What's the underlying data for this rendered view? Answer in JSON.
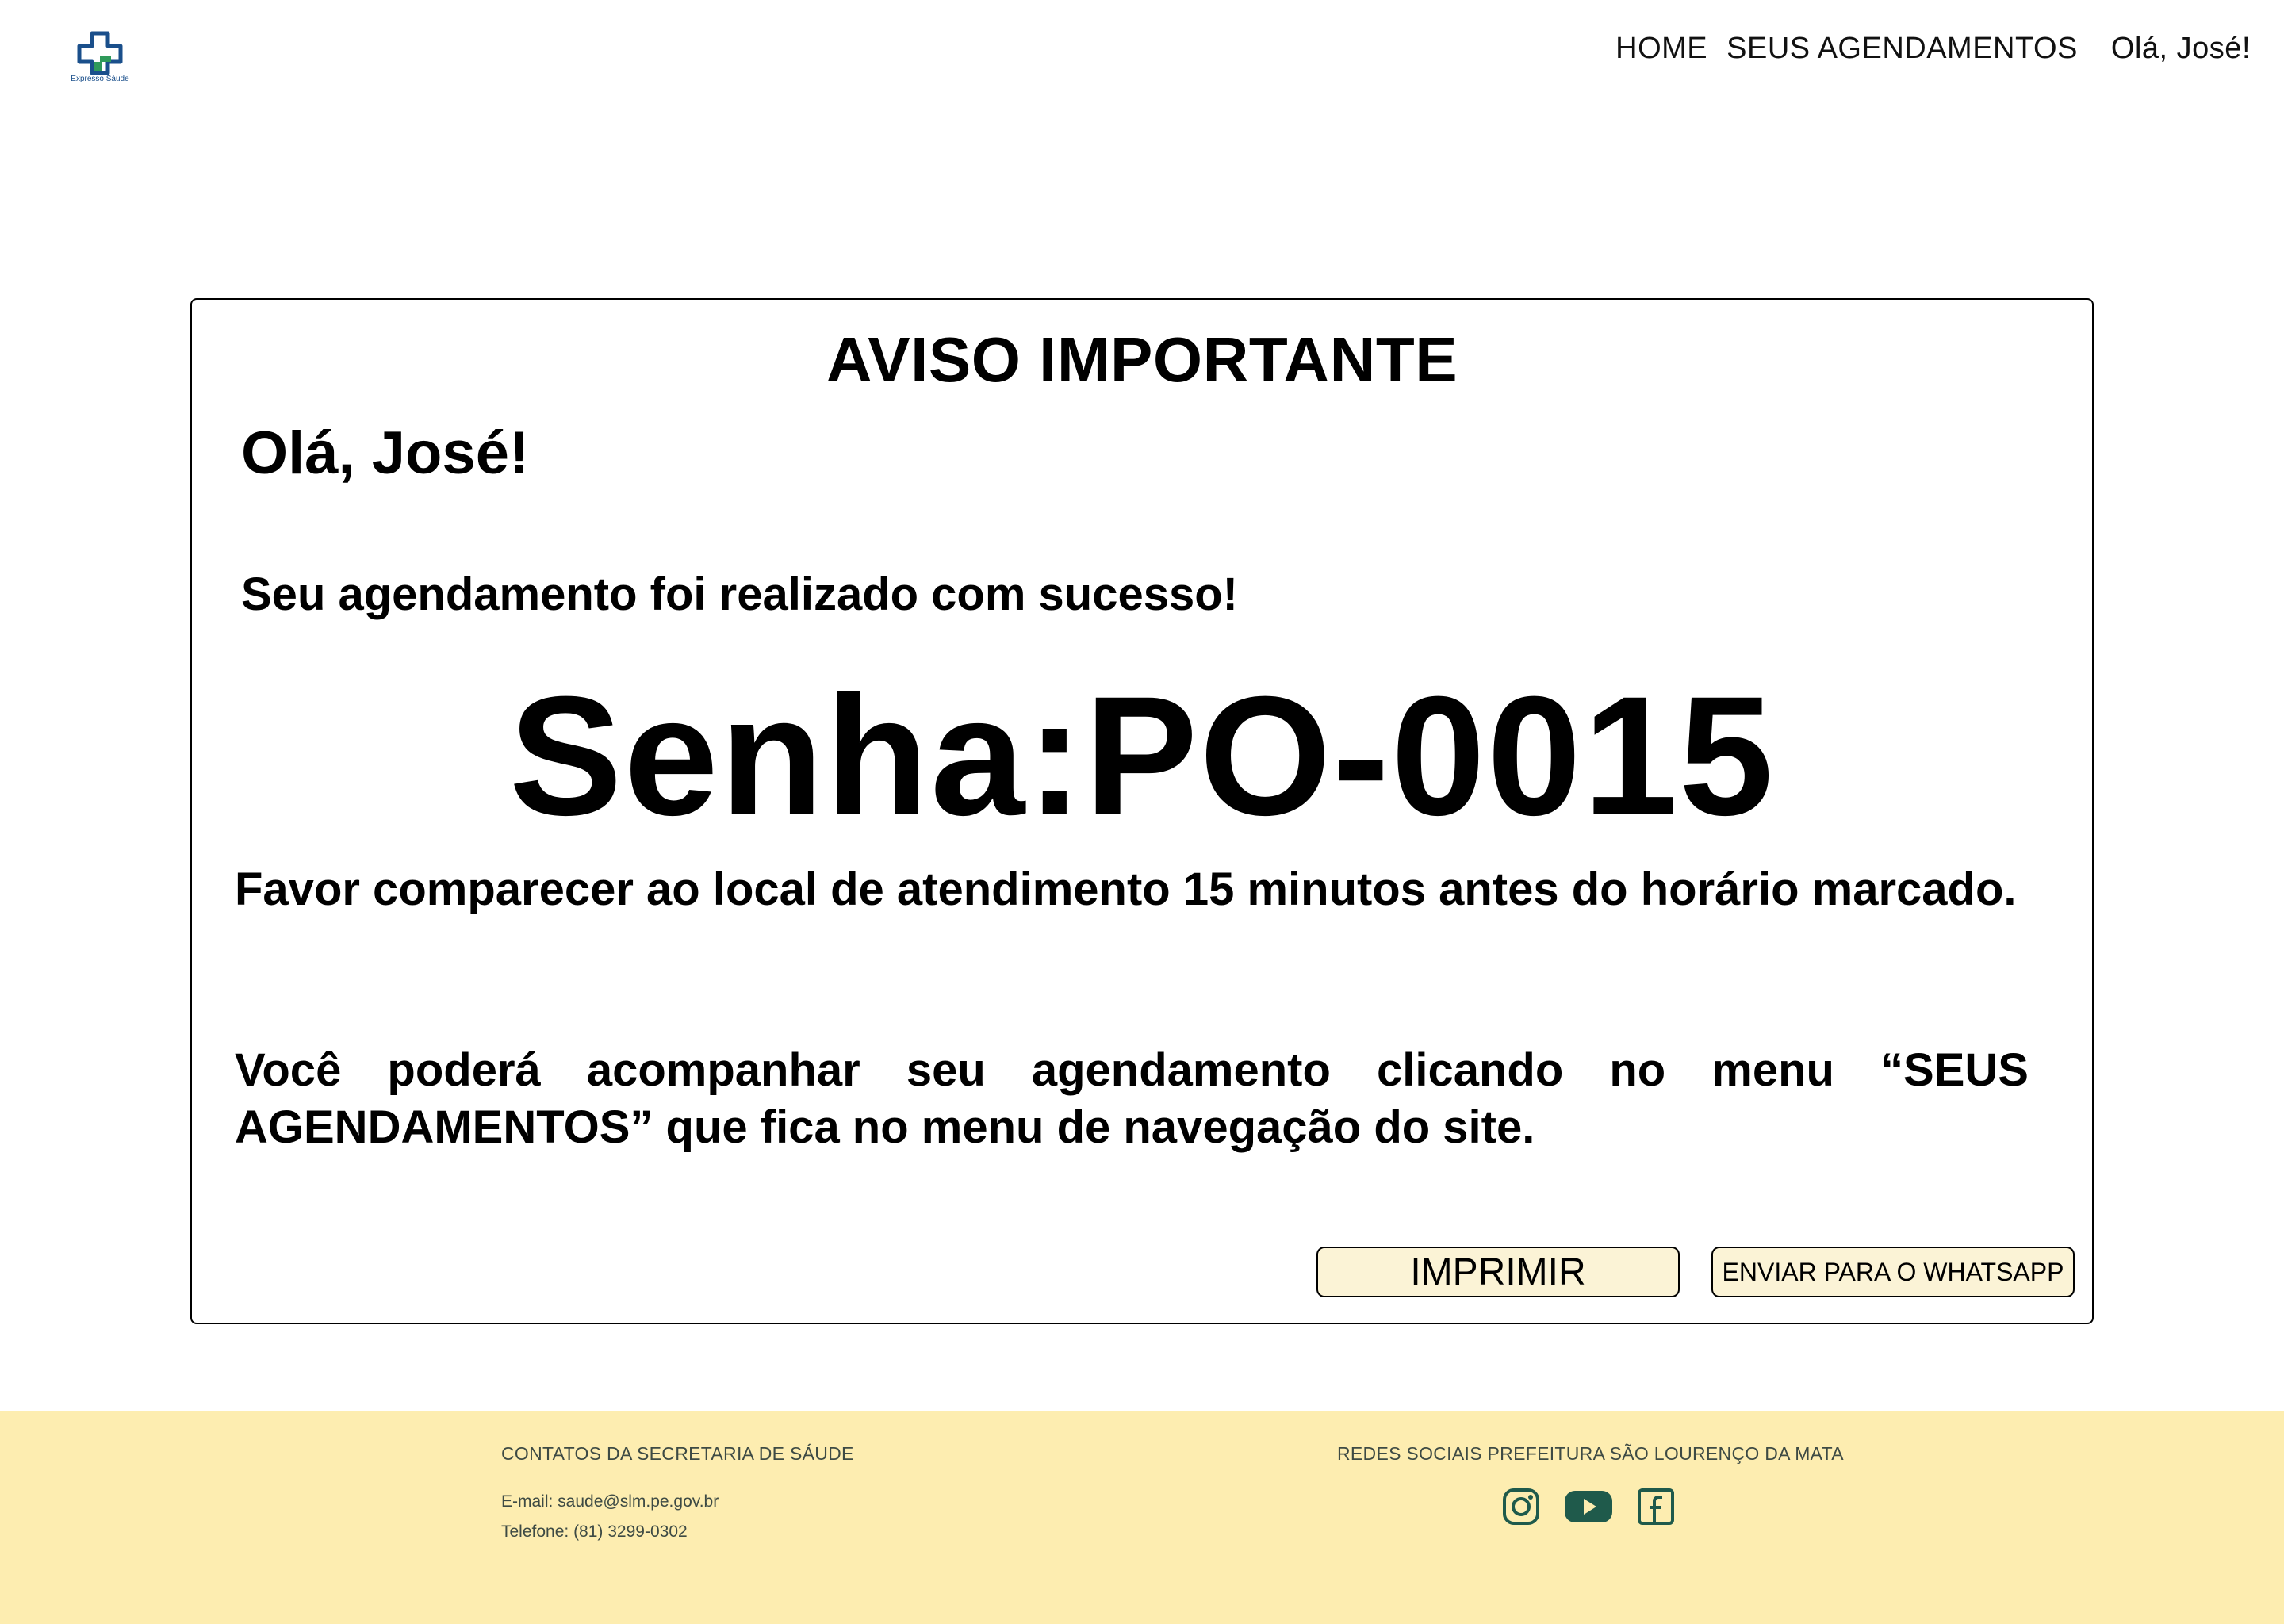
{
  "header": {
    "logo_text": "Expresso Sáude",
    "nav": {
      "home": "HOME",
      "appointments": "SEUS AGENDAMENTOS",
      "greeting": "Olá, José!"
    }
  },
  "notice": {
    "title": "AVISO IMPORTANTE",
    "greeting": "Olá, José!",
    "success": "Seu agendamento foi realizado com sucesso!",
    "ticket": "Senha:PO-0015",
    "instruction": "Favor comparecer ao local de atendimento 15 minutos antes do horário marcado.",
    "tracking": "Você poderá acompanhar seu agendamento clicando no menu “SEUS AGENDAMENTOS” que fica no menu de navegação do site.",
    "buttons": {
      "print": "IMPRIMIR",
      "whatsapp": "ENVIAR PARA O WHATSAPP"
    }
  },
  "footer": {
    "contacts_title": "CONTATOS DA SECRETARIA DE SÁUDE",
    "email": "E-mail: saude@slm.pe.gov.br",
    "phone": "Telefone: (81) 3299-0302",
    "social_title": "REDES SOCIAIS PREFEITURA SÃO LOURENÇO DA MATA",
    "social_icons": [
      "instagram-icon",
      "youtube-icon",
      "facebook-icon"
    ]
  },
  "colors": {
    "footer_bg": "#fdedb0",
    "button_bg": "#fbf3d6",
    "icon_green": "#1f5a4b",
    "logo_blue": "#1a4f8b",
    "logo_green": "#2f9a5a"
  }
}
